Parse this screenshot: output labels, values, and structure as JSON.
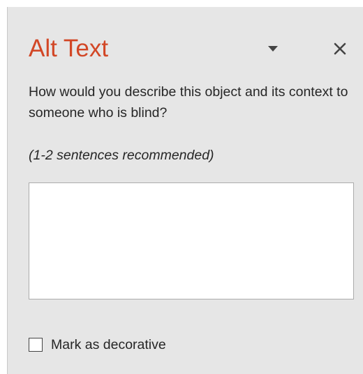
{
  "colors": {
    "title": "#d24726",
    "icon": "#444444",
    "pane_background": "#e6e6e6"
  },
  "pane": {
    "title": "Alt Text",
    "menu_icon": "caret-down-icon",
    "close_icon": "close-icon"
  },
  "prompt": "How would you describe this object and its context to someone who is blind?",
  "hint": "(1-2 sentences recommended)",
  "description": {
    "value": "",
    "placeholder": ""
  },
  "decorative": {
    "label": "Mark as decorative",
    "checked": false
  }
}
